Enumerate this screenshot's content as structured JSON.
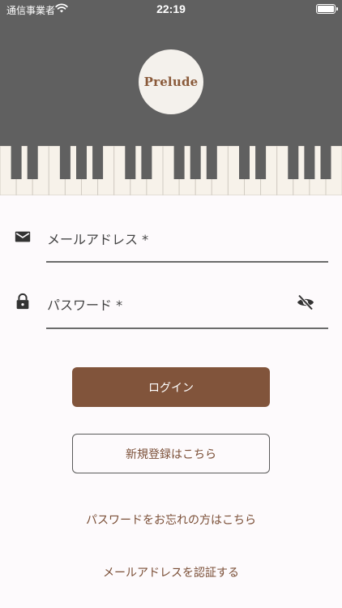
{
  "status_bar": {
    "carrier": "通信事業者",
    "time": "22:19",
    "wifi_icon": "wifi-icon",
    "battery_icon": "battery-icon"
  },
  "header": {
    "background_color": "#606060",
    "logo_text": "Prelude",
    "logo_color": "#8a5a3a"
  },
  "form": {
    "email": {
      "label": "メールアドレス *",
      "icon": "mail-icon"
    },
    "password": {
      "label": "パスワード *",
      "icon": "lock-icon",
      "toggle_icon": "eye-off-icon"
    }
  },
  "buttons": {
    "login_label": "ログイン",
    "register_label": "新規登録はこちら",
    "accent_color": "#81543b"
  },
  "links": {
    "forgot_password": "パスワードをお忘れの方はこちら",
    "verify_email": "メールアドレスを認証する"
  }
}
